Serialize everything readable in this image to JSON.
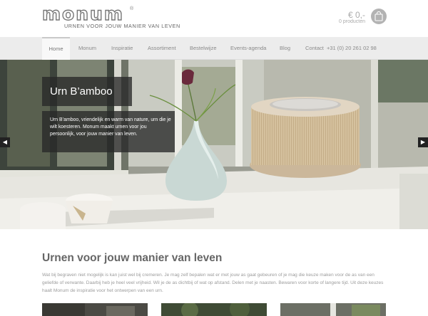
{
  "brand": {
    "logo_text": "monum",
    "registered": "®",
    "tagline": "URNEN VOOR JOUW MANIER VAN LEVEN"
  },
  "cart": {
    "price": "€ 0,-",
    "count": "0 producten",
    "icon": "shopping-bag-icon"
  },
  "nav": {
    "items": [
      {
        "label": "Home",
        "active": true
      },
      {
        "label": "Monum"
      },
      {
        "label": "Inspiratie"
      },
      {
        "label": "Assortiment"
      },
      {
        "label": "Bestelwijze"
      },
      {
        "label": "Events-agenda"
      },
      {
        "label": "Blog"
      },
      {
        "label": "Contact"
      }
    ],
    "phone": "+31 (0) 20 261 02 98"
  },
  "hero": {
    "title": "Urn B’amboo",
    "description": "Urn B’amboo, vriendelijk en warm van nature, urn die je wilt koesteren. Monum maakt urnen voor jou persoonlijk, voor jouw manier van leven.",
    "prev_icon": "chevron-left-icon",
    "next_icon": "chevron-right-icon"
  },
  "intro": {
    "title": "Urnen voor jouw manier van leven",
    "text": "Wat bij begraven niet mogelijk is kan juist wel bij cremeren. Je mag zelf bepalen wat er met jouw as gaat gebeuren of je mag die keuze maken voor de as van een geliefde of verwante. Daarbij heb je heel veel vrijheid. Wil je de as dichtbij of wat op afstand. Delen met je naasten. Bewaren voor korte of langere tijd. Uit deze keuzes haalt Monum de inspiratie voor het ontwerpen van een urn."
  },
  "colors": {
    "accent": "#777777",
    "nav_bg": "#ececec",
    "overlay": "#282828"
  }
}
